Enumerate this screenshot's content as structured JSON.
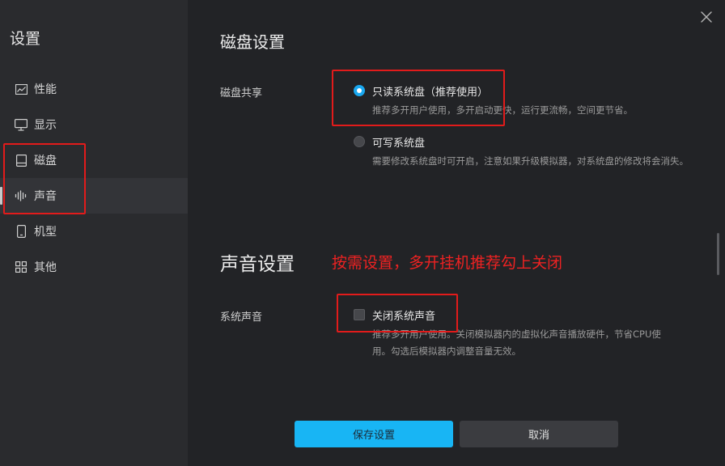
{
  "sidebar": {
    "title": "设置",
    "items": [
      {
        "label": "性能",
        "icon": "performance-icon"
      },
      {
        "label": "显示",
        "icon": "monitor-icon"
      },
      {
        "label": "磁盘",
        "icon": "disk-icon"
      },
      {
        "label": "声音",
        "icon": "sound-icon",
        "active": true
      },
      {
        "label": "机型",
        "icon": "phone-icon"
      },
      {
        "label": "其他",
        "icon": "grid-icon"
      }
    ]
  },
  "disk": {
    "title": "磁盘设置",
    "share_label": "磁盘共享",
    "options": [
      {
        "label": "只读系统盘（推荐使用）",
        "desc": "推荐多开用户使用，多开启动更快，运行更流畅，空间更节省。",
        "selected": true
      },
      {
        "label": "可写系统盘",
        "desc": "需要修改系统盘时可开启，注意如果升级模拟器，对系统盘的修改将会消失。",
        "selected": false
      }
    ]
  },
  "sound": {
    "title": "声音设置",
    "annotation": "按需设置，多开挂机推荐勾上关闭",
    "system_sound_label": "系统声音",
    "mute_label": "关闭系统声音",
    "mute_checked": false,
    "mute_desc": "推荐多开用户使用。关闭模拟器内的虚拟化声音播放硬件，节省CPU使用。勾选后模拟器内调整音量无效。"
  },
  "buttons": {
    "save": "保存设置",
    "cancel": "取消"
  },
  "colors": {
    "accent": "#18b5f4",
    "annotation": "#e21b1b",
    "sidebar_bg": "#2a2b2e",
    "content_bg": "#222326"
  }
}
